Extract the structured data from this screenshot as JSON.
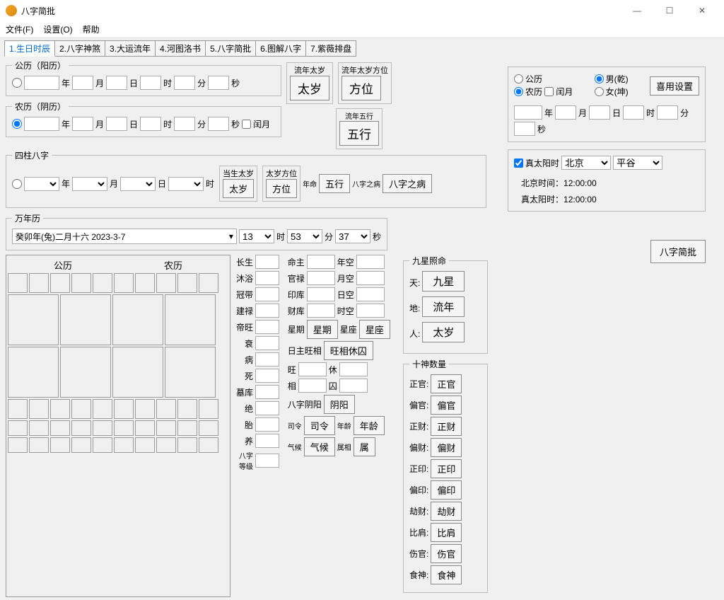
{
  "window": {
    "title": "八字简批"
  },
  "menu": {
    "file": "文件(F)",
    "settings": "设置(O)",
    "help": "帮助"
  },
  "tabs": [
    "1.生日时辰",
    "2.八字神煞",
    "3.大运流年",
    "4.河图洛书",
    "5.八字简批",
    "6.图解八字",
    "7.紫薇排盘"
  ],
  "gonli": {
    "legend": "公历（阳历）",
    "year": "年",
    "month": "月",
    "day": "日",
    "hour": "时",
    "min": "分",
    "sec": "秒"
  },
  "nongli": {
    "legend": "农历（阴历）",
    "leap": "闰月"
  },
  "sizhu": {
    "legend": "四柱八字"
  },
  "taisui": {
    "liunian_label": "流年太岁",
    "liunian_fang_label": "流年太岁方位",
    "taisui_btn": "太岁",
    "fangwei_btn": "方位",
    "wuxing_label": "流年五行",
    "wuxing_btn": "五行",
    "dangsheng_label": "当生太岁",
    "taisui_fang_label": "太岁方位",
    "nianming": "年命",
    "bazhi": "八字之病",
    "bazhi_btn": "八字之病"
  },
  "wannian": {
    "legend": "万年历",
    "value": "癸卯年(兔)二月十六 2023-3-7",
    "hour_val": "13",
    "min_val": "53",
    "sec_val": "37"
  },
  "cal": {
    "gong": "公历",
    "nong": "农历"
  },
  "twelve": [
    "长生",
    "沐浴",
    "冠带",
    "建禄",
    "帝旺",
    "衰",
    "病",
    "死",
    "墓库",
    "绝",
    "胎",
    "养"
  ],
  "bazi_dengji": "八字等级",
  "pillars": {
    "mingzhu": "命主",
    "niankon": "年空",
    "guanlu": "官禄",
    "yuekong": "月空",
    "yinku": "印库",
    "rikong": "日空",
    "caiku": "财库",
    "shikong": "时空",
    "xingqi": "星期",
    "xingqi_btn": "星期",
    "xingzuo": "星座",
    "xingzuo_btn": "星座",
    "rizhu": "日主旺相",
    "wangxiang_btn": "旺相休囚",
    "wang": "旺",
    "xiu": "休",
    "xiang": "相",
    "qiu": "囚",
    "bazi_yinyang": "八字阴阳",
    "yinyang_btn": "阴阳",
    "siling": "司令",
    "siling_btn": "司令",
    "nianling": "年龄",
    "nianling_btn": "年龄",
    "qihou": "气候",
    "qihou_btn": "气候",
    "shuxiang": "属相",
    "shu_btn": "属"
  },
  "jiuxing": {
    "legend": "九星照命",
    "tian": "天:",
    "tian_btn": "九星",
    "di": "地:",
    "di_btn": "流年",
    "ren": "人:",
    "ren_btn": "太岁"
  },
  "shishen": {
    "legend": "十神数量",
    "items": [
      {
        "k": "正官:",
        "btn": "正官"
      },
      {
        "k": "偏官:",
        "btn": "偏官"
      },
      {
        "k": "正财:",
        "btn": "正财"
      },
      {
        "k": "偏财:",
        "btn": "偏财"
      },
      {
        "k": "正印:",
        "btn": "正印"
      },
      {
        "k": "偏印:",
        "btn": "偏印"
      },
      {
        "k": "劫财:",
        "btn": "劫财"
      },
      {
        "k": "比肩:",
        "btn": "比肩"
      },
      {
        "k": "伤官:",
        "btn": "伤官"
      },
      {
        "k": "食神:",
        "btn": "食神"
      }
    ]
  },
  "right": {
    "gongli_radio": "公历",
    "nongli_radio": "农历",
    "leap_chk": "闰月",
    "male": "男(乾)",
    "female": "女(坤)",
    "xiyong_btn": "喜用设置",
    "zhentaiyang": "真太阳时",
    "city1": "北京",
    "city2": "平谷",
    "bj_label": "北京时间：",
    "bj_val": "12:00:00",
    "tz_label": "真太阳时：",
    "tz_val": "12:00:00",
    "submit_btn": "八字简批"
  }
}
